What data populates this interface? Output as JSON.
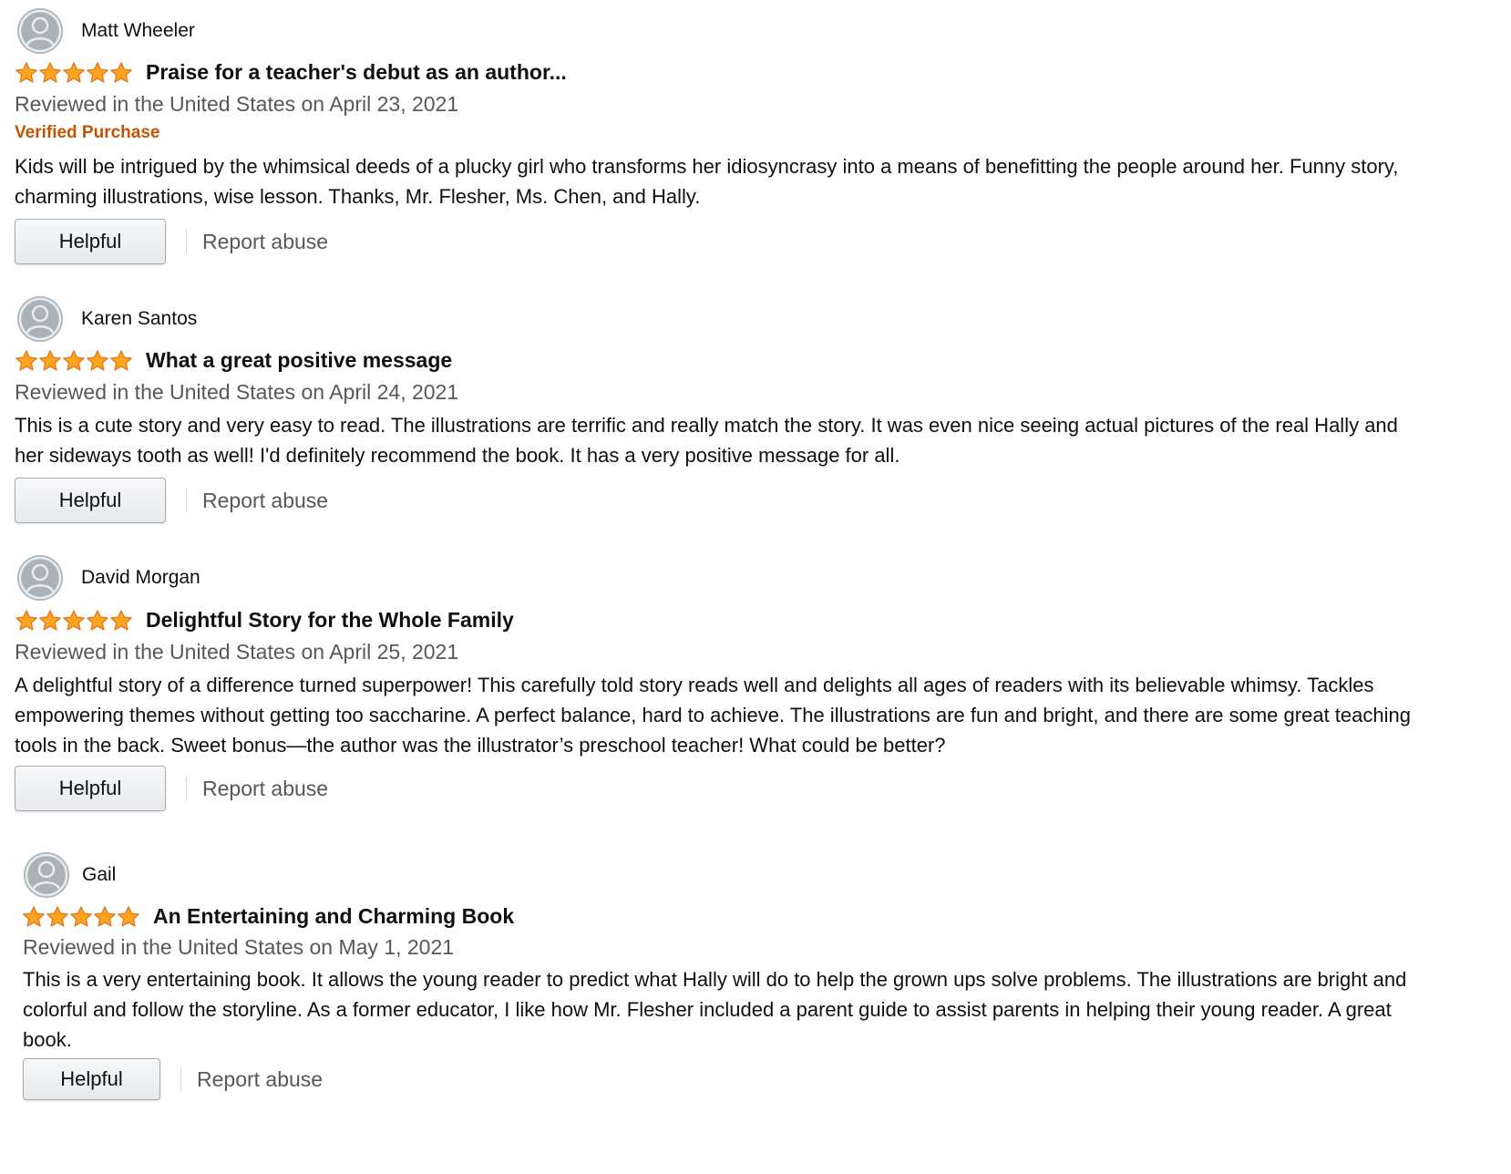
{
  "colors": {
    "star": "#ffa41c",
    "star_outline": "#de7921",
    "verified": "#c45500",
    "date": "#565959",
    "avatar": "#a9b3b9"
  },
  "reviews": [
    {
      "reviewer": "Matt Wheeler",
      "rating": 5,
      "title": "Praise for a teacher's debut as an author...",
      "date": "Reviewed in the United States on April 23, 2021",
      "verified": "Verified Purchase",
      "body": "Kids will be intrigued by the whimsical deeds of a plucky girl who transforms her idiosyncrasy into a means of benefitting the people around her. Funny story, charming illustrations, wise lesson. Thanks, Mr. Flesher, Ms. Chen, and Hally.",
      "helpful_label": "Helpful",
      "report_label": "Report abuse"
    },
    {
      "reviewer": "Karen Santos",
      "rating": 5,
      "title": "What a great positive message",
      "date": "Reviewed in the United States on April 24, 2021",
      "verified": "",
      "body": "This is a cute story and very easy to read. The illustrations are terrific and really match the story. It was even nice seeing actual pictures of the real Hally and her sideways tooth as well! I'd definitely recommend the book. It has a very positive message for all.",
      "helpful_label": "Helpful",
      "report_label": "Report abuse"
    },
    {
      "reviewer": "David Morgan",
      "rating": 5,
      "title": "Delightful Story for the Whole Family",
      "date": "Reviewed in the United States on April 25, 2021",
      "verified": "",
      "body": "A delightful story of a difference turned superpower! This carefully told story reads well and delights all ages of readers with its believable whimsy. Tackles empowering themes without getting too saccharine. A perfect balance, hard to achieve. The illustrations are fun and bright, and there are some great teaching tools in the back. Sweet bonus—the author was the illustrator’s preschool teacher! What could be better?",
      "helpful_label": "Helpful",
      "report_label": "Report abuse"
    },
    {
      "reviewer": "Gail",
      "rating": 5,
      "title": "An Entertaining and Charming Book",
      "date": "Reviewed in the United States on May 1, 2021",
      "verified": "",
      "body": "This is a very entertaining book. It allows the young reader to predict what Hally will do to help the grown ups solve problems. The illustrations are bright and colorful and follow the storyline. As a former educator, I like how Mr. Flesher included a parent guide to assist parents in helping their young reader. A great book.",
      "helpful_label": "Helpful",
      "report_label": "Report abuse"
    }
  ]
}
